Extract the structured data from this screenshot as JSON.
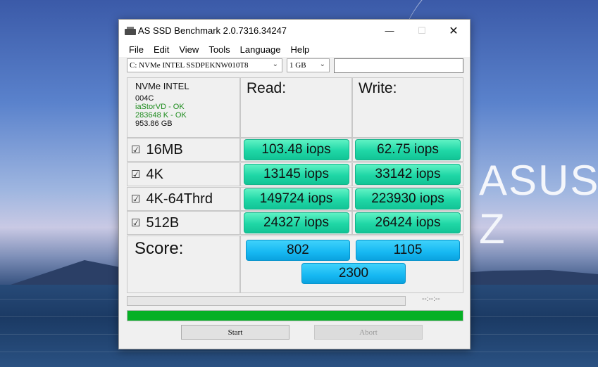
{
  "background": {
    "brand_text": "ASUS Z"
  },
  "window": {
    "title": "AS SSD Benchmark 2.0.7316.34247",
    "controls": {
      "minimize": "—",
      "maximize": "☐",
      "close": "✕"
    }
  },
  "menu": [
    "File",
    "Edit",
    "View",
    "Tools",
    "Language",
    "Help"
  ],
  "toolbar": {
    "drive_select": "C: NVMe INTEL SSDPEKNW010T8",
    "size_select": "1 GB",
    "text_field": ""
  },
  "drive_info": {
    "model": "NVMe INTEL",
    "firmware": "004C",
    "driver": "iaStorVD - OK",
    "alignment": "283648 K - OK",
    "capacity": "953.86 GB"
  },
  "headers": {
    "read": "Read:",
    "write": "Write:"
  },
  "rows": [
    {
      "label": "16MB",
      "checked": true,
      "read": "103.48 iops",
      "write": "62.75 iops"
    },
    {
      "label": "4K",
      "checked": true,
      "read": "13145 iops",
      "write": "33142 iops"
    },
    {
      "label": "4K-64Thrd",
      "checked": true,
      "read": "149724 iops",
      "write": "223930 iops"
    },
    {
      "label": "512B",
      "checked": true,
      "read": "24327 iops",
      "write": "26424 iops"
    }
  ],
  "checkbox_glyph": "☑",
  "score": {
    "label": "Score:",
    "read": "802",
    "write": "1105",
    "total": "2300"
  },
  "progress": {
    "timer": "--:--:--",
    "bar_fraction": 1.0,
    "bar_color": "#06b025"
  },
  "buttons": {
    "start": "Start",
    "abort": "Abort"
  },
  "colors": {
    "result_green": "#1fd7a6",
    "score_blue": "#16b8f2"
  }
}
